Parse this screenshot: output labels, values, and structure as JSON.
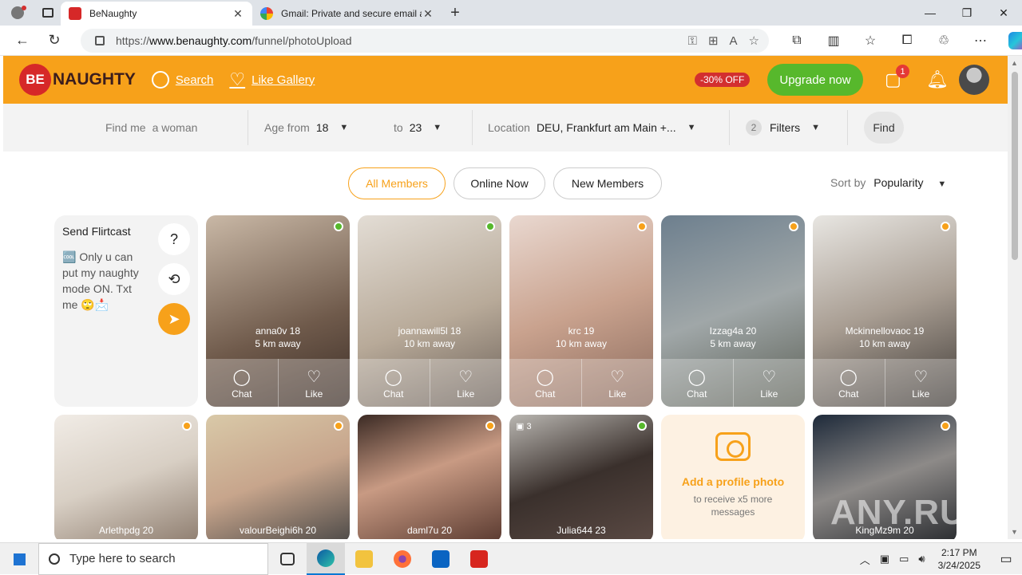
{
  "browser": {
    "tabs": [
      {
        "title": "BeNaughty",
        "active": true
      },
      {
        "title": "Gmail: Private and secure email at no cost | Google Workspace",
        "active": false
      }
    ],
    "url_prefix": "https://",
    "url_host": "www.benaughty.com",
    "url_path": "/funnel/photoUpload"
  },
  "site": {
    "logo_be": "BE",
    "logo_rest": "NAUGHTY",
    "nav": {
      "search": "Search",
      "like_gallery": "Like Gallery"
    },
    "discount": "-30% OFF",
    "upgrade": "Upgrade now",
    "messages_badge": "1",
    "accent_color": "#f7a11a",
    "upgrade_color": "#57b82c"
  },
  "filters": {
    "find_me_label": "Find me",
    "find_me_value": "a woman",
    "age_from_label": "Age from",
    "age_from_value": "18",
    "age_to_label": "to",
    "age_to_value": "23",
    "location_label": "Location",
    "location_value": "DEU, Frankfurt am Main +...",
    "filters_count": "2",
    "filters_label": "Filters",
    "find_button": "Find"
  },
  "member_tabs": [
    "All Members",
    "Online Now",
    "New Members"
  ],
  "sort": {
    "label": "Sort by",
    "value": "Popularity"
  },
  "flirtcast": {
    "title": "Send Flirtcast",
    "message": "🆒 Only u can put my naughty mode ON. Txt me 🙄📩"
  },
  "actions": {
    "chat": "Chat",
    "like": "Like"
  },
  "members_row1": [
    {
      "name": "annа0v 18",
      "distance": "5 km away",
      "online": "green"
    },
    {
      "name": "joannawill5l 18",
      "distance": "10 km away",
      "online": "green"
    },
    {
      "name": "krc 19",
      "distance": "10 km away",
      "online": "orange"
    },
    {
      "name": "Izzag4a 20",
      "distance": "5 km away",
      "online": "orange"
    },
    {
      "name": "Mckinnellovaoc 19",
      "distance": "10 km away",
      "online": "orange"
    }
  ],
  "members_row2": [
    {
      "name": "Arlethpdg 20",
      "online": "orange"
    },
    {
      "name": "valourBeighi6h 20",
      "online": "orange"
    },
    {
      "name": "daml7u 20",
      "online": "orange"
    },
    {
      "name": "Julia644 23",
      "online": "green",
      "photos": "3"
    },
    {
      "name": "KingMz9m 20",
      "online": "orange"
    }
  ],
  "add_photo": {
    "title": "Add a profile photo",
    "subtitle": "to receive x5 more messages"
  },
  "watermark": "ANY.RUN",
  "taskbar": {
    "search_placeholder": "Type here to search",
    "time": "2:17 PM",
    "date": "3/24/2025"
  }
}
